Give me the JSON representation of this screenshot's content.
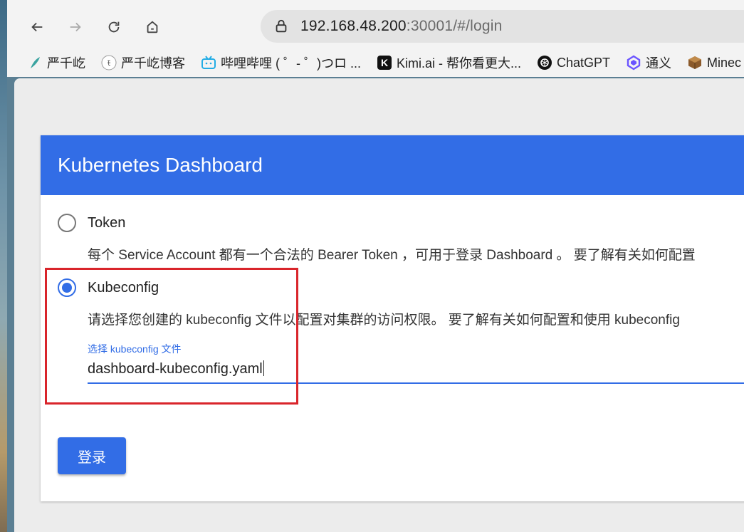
{
  "browser": {
    "url_host": "192.168.48.200",
    "url_rest": ":30001/#/login",
    "bookmarks": [
      {
        "label": "严千屹",
        "icon": "feather-icon",
        "color": "#3aa3a0"
      },
      {
        "label": "严千屹博客",
        "icon": "blog-logo-icon",
        "color": "#333333"
      },
      {
        "label": "哔哩哔哩 ( ゜- ゜)つロ ...",
        "icon": "bilibili-icon",
        "color": "#23ade5"
      },
      {
        "label": "Kimi.ai - 帮你看更大...",
        "icon": "kimi-icon",
        "color": "#111111"
      },
      {
        "label": "ChatGPT",
        "icon": "chatgpt-icon",
        "color": "#111111"
      },
      {
        "label": "通义",
        "icon": "tongyi-icon",
        "color": "#6b54ff"
      },
      {
        "label": "Minec",
        "icon": "minecraft-icon",
        "color": "#8b5a2b"
      }
    ]
  },
  "dashboard": {
    "title": "Kubernetes Dashboard",
    "token_label": "Token",
    "token_desc": "每个 Service Account 都有一个合法的 Bearer Token ，可用于登录 Dashboard 。 要了解有关如何配置",
    "kubeconfig_label": "Kubeconfig",
    "kubeconfig_desc": "请选择您创建的 kubeconfig 文件以配置对集群的访问权限。 要了解有关如何配置和使用 kubeconfig",
    "file_label": "选择 kubeconfig 文件",
    "file_value": "dashboard-kubeconfig.yaml",
    "login_label": "登录",
    "selected": "kubeconfig"
  },
  "colors": {
    "accent": "#326de6",
    "highlight": "#d9252b"
  }
}
